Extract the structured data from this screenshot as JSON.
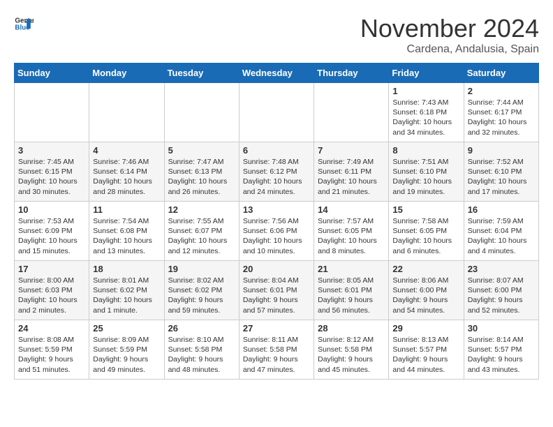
{
  "header": {
    "logo_line1": "General",
    "logo_line2": "Blue",
    "month": "November 2024",
    "location": "Cardena, Andalusia, Spain"
  },
  "days_of_week": [
    "Sunday",
    "Monday",
    "Tuesday",
    "Wednesday",
    "Thursday",
    "Friday",
    "Saturday"
  ],
  "weeks": [
    [
      {
        "day": "",
        "text": ""
      },
      {
        "day": "",
        "text": ""
      },
      {
        "day": "",
        "text": ""
      },
      {
        "day": "",
        "text": ""
      },
      {
        "day": "",
        "text": ""
      },
      {
        "day": "1",
        "text": "Sunrise: 7:43 AM\nSunset: 6:18 PM\nDaylight: 10 hours and 34 minutes."
      },
      {
        "day": "2",
        "text": "Sunrise: 7:44 AM\nSunset: 6:17 PM\nDaylight: 10 hours and 32 minutes."
      }
    ],
    [
      {
        "day": "3",
        "text": "Sunrise: 7:45 AM\nSunset: 6:15 PM\nDaylight: 10 hours and 30 minutes."
      },
      {
        "day": "4",
        "text": "Sunrise: 7:46 AM\nSunset: 6:14 PM\nDaylight: 10 hours and 28 minutes."
      },
      {
        "day": "5",
        "text": "Sunrise: 7:47 AM\nSunset: 6:13 PM\nDaylight: 10 hours and 26 minutes."
      },
      {
        "day": "6",
        "text": "Sunrise: 7:48 AM\nSunset: 6:12 PM\nDaylight: 10 hours and 24 minutes."
      },
      {
        "day": "7",
        "text": "Sunrise: 7:49 AM\nSunset: 6:11 PM\nDaylight: 10 hours and 21 minutes."
      },
      {
        "day": "8",
        "text": "Sunrise: 7:51 AM\nSunset: 6:10 PM\nDaylight: 10 hours and 19 minutes."
      },
      {
        "day": "9",
        "text": "Sunrise: 7:52 AM\nSunset: 6:10 PM\nDaylight: 10 hours and 17 minutes."
      }
    ],
    [
      {
        "day": "10",
        "text": "Sunrise: 7:53 AM\nSunset: 6:09 PM\nDaylight: 10 hours and 15 minutes."
      },
      {
        "day": "11",
        "text": "Sunrise: 7:54 AM\nSunset: 6:08 PM\nDaylight: 10 hours and 13 minutes."
      },
      {
        "day": "12",
        "text": "Sunrise: 7:55 AM\nSunset: 6:07 PM\nDaylight: 10 hours and 12 minutes."
      },
      {
        "day": "13",
        "text": "Sunrise: 7:56 AM\nSunset: 6:06 PM\nDaylight: 10 hours and 10 minutes."
      },
      {
        "day": "14",
        "text": "Sunrise: 7:57 AM\nSunset: 6:05 PM\nDaylight: 10 hours and 8 minutes."
      },
      {
        "day": "15",
        "text": "Sunrise: 7:58 AM\nSunset: 6:05 PM\nDaylight: 10 hours and 6 minutes."
      },
      {
        "day": "16",
        "text": "Sunrise: 7:59 AM\nSunset: 6:04 PM\nDaylight: 10 hours and 4 minutes."
      }
    ],
    [
      {
        "day": "17",
        "text": "Sunrise: 8:00 AM\nSunset: 6:03 PM\nDaylight: 10 hours and 2 minutes."
      },
      {
        "day": "18",
        "text": "Sunrise: 8:01 AM\nSunset: 6:02 PM\nDaylight: 10 hours and 1 minute."
      },
      {
        "day": "19",
        "text": "Sunrise: 8:02 AM\nSunset: 6:02 PM\nDaylight: 9 hours and 59 minutes."
      },
      {
        "day": "20",
        "text": "Sunrise: 8:04 AM\nSunset: 6:01 PM\nDaylight: 9 hours and 57 minutes."
      },
      {
        "day": "21",
        "text": "Sunrise: 8:05 AM\nSunset: 6:01 PM\nDaylight: 9 hours and 56 minutes."
      },
      {
        "day": "22",
        "text": "Sunrise: 8:06 AM\nSunset: 6:00 PM\nDaylight: 9 hours and 54 minutes."
      },
      {
        "day": "23",
        "text": "Sunrise: 8:07 AM\nSunset: 6:00 PM\nDaylight: 9 hours and 52 minutes."
      }
    ],
    [
      {
        "day": "24",
        "text": "Sunrise: 8:08 AM\nSunset: 5:59 PM\nDaylight: 9 hours and 51 minutes."
      },
      {
        "day": "25",
        "text": "Sunrise: 8:09 AM\nSunset: 5:59 PM\nDaylight: 9 hours and 49 minutes."
      },
      {
        "day": "26",
        "text": "Sunrise: 8:10 AM\nSunset: 5:58 PM\nDaylight: 9 hours and 48 minutes."
      },
      {
        "day": "27",
        "text": "Sunrise: 8:11 AM\nSunset: 5:58 PM\nDaylight: 9 hours and 47 minutes."
      },
      {
        "day": "28",
        "text": "Sunrise: 8:12 AM\nSunset: 5:58 PM\nDaylight: 9 hours and 45 minutes."
      },
      {
        "day": "29",
        "text": "Sunrise: 8:13 AM\nSunset: 5:57 PM\nDaylight: 9 hours and 44 minutes."
      },
      {
        "day": "30",
        "text": "Sunrise: 8:14 AM\nSunset: 5:57 PM\nDaylight: 9 hours and 43 minutes."
      }
    ]
  ]
}
